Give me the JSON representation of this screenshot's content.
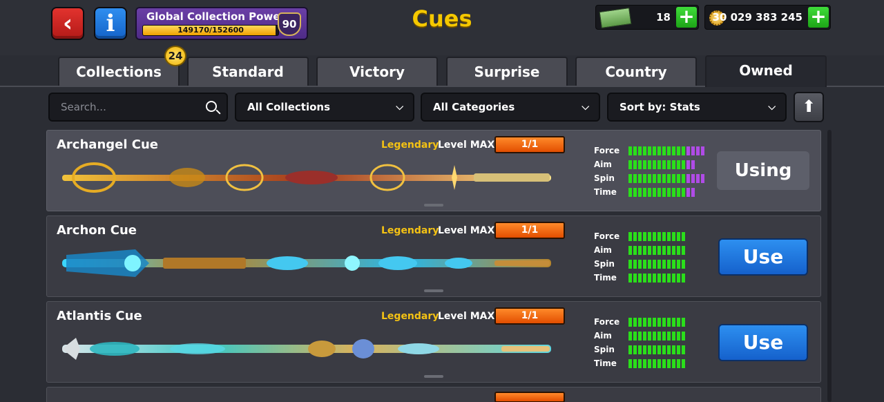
{
  "header": {
    "back_icon": "‹",
    "info_icon": "i",
    "power": {
      "title": "Global Collection Power",
      "progress": "149170/152600",
      "fraction": 0.9775,
      "level": "90"
    },
    "title": "Cues",
    "cash": "18",
    "coins": "30 029 383 245",
    "plus": "+"
  },
  "tabs": [
    {
      "label": "Collections",
      "badge": "24"
    },
    {
      "label": "Standard"
    },
    {
      "label": "Victory"
    },
    {
      "label": "Surprise"
    },
    {
      "label": "Country"
    },
    {
      "label": "Owned",
      "active": true
    }
  ],
  "filters": {
    "search_placeholder": "Search...",
    "collection": "All Collections",
    "category": "All Categories",
    "sort": "Sort by: Stats",
    "up_icon": "⬆"
  },
  "stat_labels": [
    "Force",
    "Aim",
    "Spin",
    "Time"
  ],
  "cues": [
    {
      "name": "Archangel Cue",
      "rarity": "Legendary",
      "level": "Level MAX",
      "owned": "1/1",
      "stats": [
        [
          12,
          4
        ],
        [
          12,
          2
        ],
        [
          12,
          4
        ],
        [
          12,
          2
        ]
      ],
      "action": "Using",
      "selected": true
    },
    {
      "name": "Archon Cue",
      "rarity": "Legendary",
      "level": "Level MAX",
      "owned": "1/1",
      "stats": [
        [
          12,
          0
        ],
        [
          12,
          0
        ],
        [
          12,
          0
        ],
        [
          12,
          0
        ]
      ],
      "action": "Use",
      "selected": false
    },
    {
      "name": "Atlantis Cue",
      "rarity": "Legendary",
      "level": "Level MAX",
      "owned": "1/1",
      "stats": [
        [
          12,
          0
        ],
        [
          12,
          0
        ],
        [
          12,
          0
        ],
        [
          12,
          0
        ]
      ],
      "action": "Use",
      "selected": false
    }
  ],
  "colors": {
    "accent_gold": "#f5c800",
    "stat_green": "#2adf1a",
    "stat_purple": "#b04be6",
    "use_blue": "#1f78e0"
  }
}
